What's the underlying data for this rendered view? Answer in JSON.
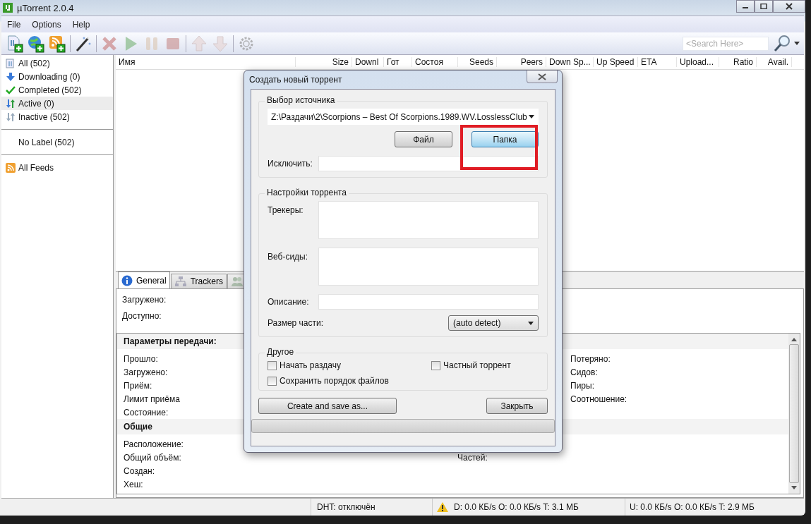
{
  "window": {
    "title": "µTorrent 2.0.4"
  },
  "menu": [
    "File",
    "Options",
    "Help"
  ],
  "toolbar": [
    {
      "kind": "add-file",
      "disabled": false
    },
    {
      "kind": "add-url",
      "disabled": false
    },
    {
      "kind": "add-rss",
      "disabled": false
    },
    {
      "kind": "wand",
      "disabled": false
    },
    {
      "kind": "remove",
      "disabled": true
    },
    {
      "kind": "start",
      "disabled": true
    },
    {
      "kind": "pause",
      "disabled": true
    },
    {
      "kind": "stop",
      "disabled": true
    },
    {
      "kind": "up",
      "disabled": true
    },
    {
      "kind": "down",
      "disabled": true
    },
    {
      "kind": "settings",
      "disabled": true
    }
  ],
  "search": {
    "placeholder": "<Search Here>"
  },
  "sidebar": {
    "groups": [
      [
        {
          "label": "All (502)",
          "kind": "all",
          "selected": false
        },
        {
          "label": "Downloading (0)",
          "kind": "down",
          "selected": false
        },
        {
          "label": "Completed (502)",
          "kind": "check",
          "selected": false
        },
        {
          "label": "Active (0)",
          "kind": "active",
          "selected": true
        },
        {
          "label": "Inactive (502)",
          "kind": "inactive",
          "selected": false
        }
      ],
      [
        {
          "label": "No Label (502)",
          "kind": "label",
          "selected": false
        }
      ],
      [
        {
          "label": "All Feeds",
          "kind": "rss",
          "selected": false
        }
      ]
    ]
  },
  "table": {
    "columns": [
      "Имя",
      "Size",
      "Downl",
      "Гот",
      "Состоя",
      "Seeds",
      "Peers",
      "Down Sp...",
      "Up Speed",
      "ETA",
      "Upload...",
      "Ratio",
      "Avail."
    ]
  },
  "tabs": [
    {
      "label": "General",
      "kind": "info",
      "selected": true
    },
    {
      "label": "Trackers",
      "kind": "network",
      "selected": false
    },
    {
      "kind": "peers",
      "selected": false
    }
  ],
  "details": {
    "top": [
      "Загружено:",
      "Доступно:"
    ],
    "sections": [
      {
        "title": "Параметры передачи:",
        "rows": [
          {
            "left": "Прошло:",
            "right": "Потеряно:"
          },
          {
            "left": "Загружено:",
            "right": "Сидов:"
          },
          {
            "left": "Приём:",
            "right": "Пиры:"
          },
          {
            "left": "Лимит приёма",
            "right": "Соотношение:"
          },
          {
            "left": "Состояние:"
          }
        ]
      },
      {
        "title": "Общие",
        "rows": [
          {
            "left": "Расположение:"
          },
          {
            "left": "Общий объём:",
            "center": "Частей:"
          },
          {
            "left": "Создан:"
          },
          {
            "left": "Хеш:"
          }
        ]
      }
    ]
  },
  "status_bar": {
    "dht": "DHT: отключён",
    "warning": true,
    "download": "D: 0.0 КБ/s O: 0.0 КБ/s T: 3.1 МБ",
    "upload": "U: 0.0 КБ/s O: 0.0 КБ/s T: 2.9 МБ"
  },
  "dialog": {
    "title": "Создать новый торрент",
    "source_group": {
      "title": "Выбор источника",
      "path": "Z:\\Раздачи\\2\\Scorpions – Best Of Scorpions.1989.WV.LosslessClub",
      "buttons": [
        {
          "label": "Файл",
          "highlighted": false
        },
        {
          "label": "Папка",
          "highlighted": true
        }
      ],
      "exclude_label": "Исключить:"
    },
    "settings_group": {
      "title": "Настройки торрента",
      "trackers_label": "Трекеры:",
      "webseeds_label": "Веб-сиды:",
      "description_label": "Описание:",
      "piece_size_label": "Размер части:",
      "piece_size": "(auto detect)"
    },
    "other_group": {
      "title": "Другое",
      "options": [
        {
          "label": "Начать раздачу",
          "checked": false
        },
        {
          "label": "Частный торрент",
          "checked": false
        },
        {
          "label": "Сохранить порядок файлов",
          "checked": false
        }
      ]
    },
    "create_button": "Create and save as...",
    "close_button": "Закрыть",
    "progress": {
      "level": 0
    }
  }
}
